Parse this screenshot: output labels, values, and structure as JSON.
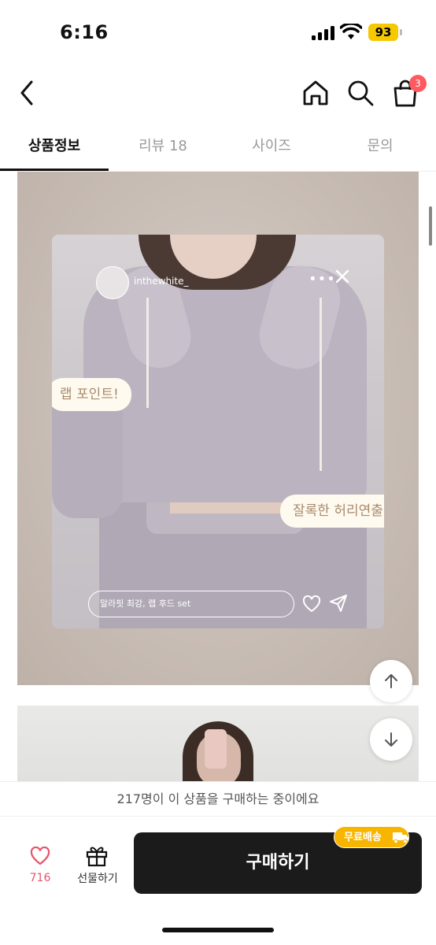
{
  "status_bar": {
    "time": "6:16",
    "battery": "93"
  },
  "header": {
    "cart_count": "3",
    "icons": [
      "back-icon",
      "home-icon",
      "search-icon",
      "cart-icon"
    ]
  },
  "tabs": [
    {
      "label": "상품정보",
      "active": true
    },
    {
      "label": "리뷰 18",
      "active": false
    },
    {
      "label": "사이즈",
      "active": false
    },
    {
      "label": "문의",
      "active": false
    }
  ],
  "story": {
    "username": "inthewhite_",
    "more": "•••",
    "bubble_1": "랩 포인트!",
    "bubble_2": "잘록한 허리연출!",
    "message_placeholder": "말라핏 최강, 랩 후드 set"
  },
  "purchase_notice": "217명이 이 상품을 구매하는 중이에요",
  "bottom_bar": {
    "like_count": "716",
    "gift_label": "선물하기",
    "buy_label": "구매하기",
    "free_shipping_badge": "무료배송"
  },
  "colors": {
    "accent_red": "#e5566b",
    "badge_red": "#ff5a5f",
    "badge_yellow": "#f7b500",
    "buy_button": "#1b1b1b"
  }
}
